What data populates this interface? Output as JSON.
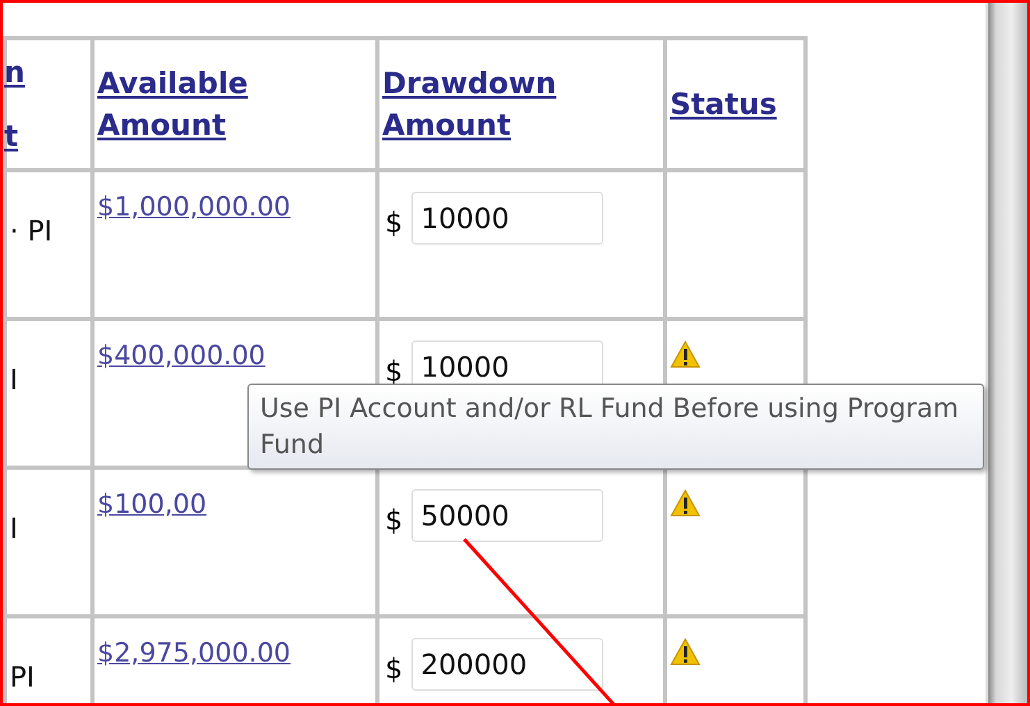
{
  "table": {
    "columns": [
      {
        "label": "n\nt"
      },
      {
        "label": "Available Amount"
      },
      {
        "label": "Drawdown Amount"
      },
      {
        "label": "Status"
      }
    ],
    "rows": [
      {
        "column_1": "· PI",
        "available": "$1,000,000.00",
        "currency": "$",
        "drawdown": "10000",
        "warning": false
      },
      {
        "column_1": "I",
        "available": "$400,000.00",
        "currency": "$",
        "drawdown": "10000",
        "warning": true
      },
      {
        "column_1": "I",
        "available": "$100,00",
        "currency": "$",
        "drawdown": "50000",
        "warning": true
      },
      {
        "column_1": "PI",
        "available": "$2,975,000.00",
        "currency": "$",
        "drawdown": "200000",
        "warning": true
      }
    ]
  },
  "tooltip": {
    "text": "Use PI Account and/or RL Fund Before using Program Fund"
  }
}
